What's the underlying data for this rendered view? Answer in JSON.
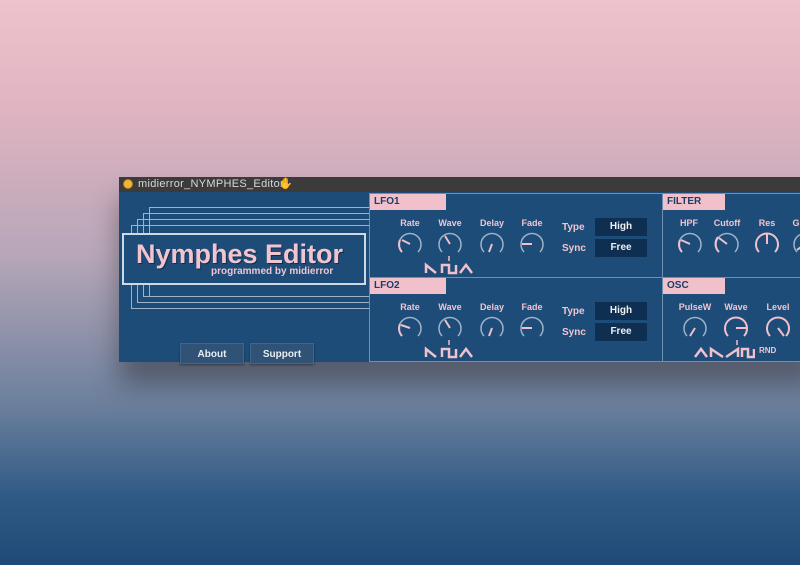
{
  "window": {
    "title": "midierror_NYMPHES_Editor"
  },
  "brand": {
    "title": "Nymphes Editor",
    "subtitle": "programmed by midierror"
  },
  "buttons": {
    "about": "About",
    "support": "Support"
  },
  "lfo1": {
    "label": "LFO1",
    "knobs": [
      "Rate",
      "Wave",
      "Delay",
      "Fade"
    ],
    "type_label": "Type",
    "type_value": "High",
    "sync_label": "Sync",
    "sync_value": "Free",
    "wave_icons": [
      "ramp-down-icon",
      "square-icon",
      "triangle-icon"
    ]
  },
  "lfo2": {
    "label": "LFO2",
    "knobs": [
      "Rate",
      "Wave",
      "Delay",
      "Fade"
    ],
    "type_label": "Type",
    "type_value": "High",
    "sync_label": "Sync",
    "sync_value": "Free",
    "wave_icons": [
      "ramp-down-icon",
      "square-icon",
      "triangle-icon"
    ]
  },
  "filter": {
    "label": "FILTER",
    "knobs": [
      "HPF",
      "Cutoff",
      "Res",
      "G"
    ]
  },
  "osc": {
    "label": "OSC",
    "knobs": [
      "PulseW",
      "Wave",
      "Level"
    ],
    "wave_icons": [
      "triangle-icon",
      "saw-icon",
      "ramp-icon",
      "square-icon"
    ],
    "rnd_label": "RND"
  },
  "colors": {
    "panel": "#1d4c79",
    "accent_pink": "#f0c0cb",
    "select_bg": "#0f2f52"
  }
}
